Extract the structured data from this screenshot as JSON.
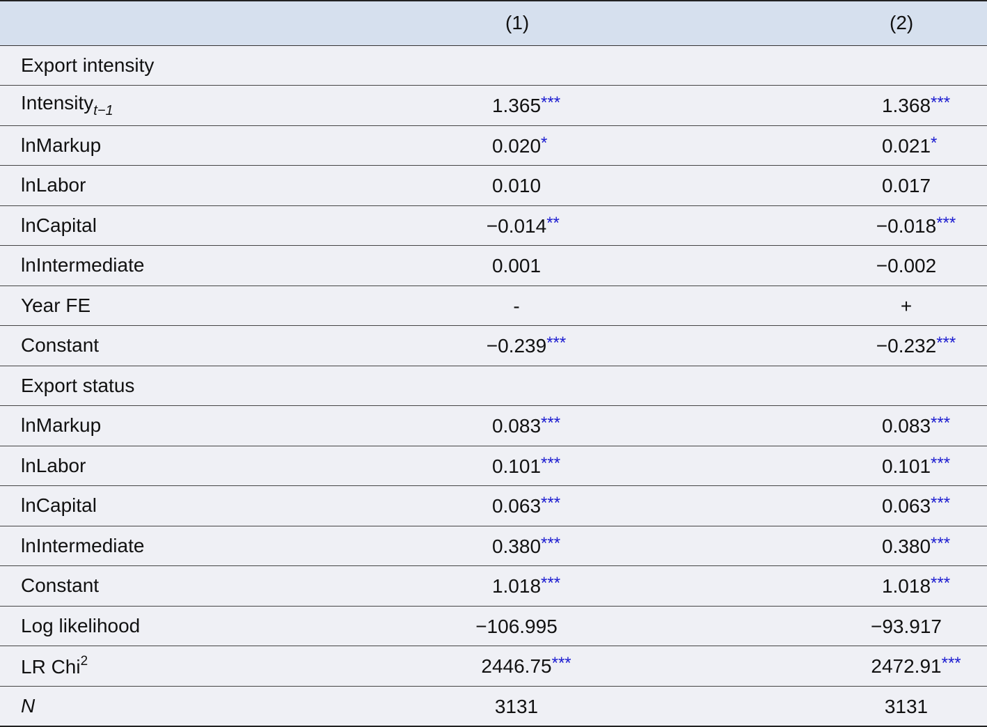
{
  "header": {
    "col0": "",
    "col1": "(1)",
    "col2": "(2)"
  },
  "rows": [
    {
      "label": "Export intensity",
      "v1": "",
      "s1": "",
      "v2": "",
      "s2": ""
    },
    {
      "label": "Intensity",
      "sub": "t−1",
      "v1": "1.365",
      "s1": "***",
      "v2": "1.368",
      "s2": "***"
    },
    {
      "label": "lnMarkup",
      "v1": "0.020",
      "s1": "*",
      "v2": "0.021",
      "s2": "*"
    },
    {
      "label": "lnLabor",
      "v1": "0.010",
      "s1": "",
      "v2": "0.017",
      "s2": ""
    },
    {
      "label": "lnCapital",
      "v1": "−0.014",
      "s1": "**",
      "v2": "−0.018",
      "s2": "***"
    },
    {
      "label": "lnIntermediate",
      "v1": "0.001",
      "s1": "",
      "v2": "−0.002",
      "s2": ""
    },
    {
      "label": "Year FE",
      "v1": "-",
      "s1": "",
      "v2": "+",
      "s2": ""
    },
    {
      "label": "Constant",
      "v1": "−0.239",
      "s1": "***",
      "v2": "−0.232",
      "s2": "***"
    },
    {
      "label": "Export status",
      "v1": "",
      "s1": "",
      "v2": "",
      "s2": ""
    },
    {
      "label": "lnMarkup",
      "v1": "0.083",
      "s1": "***",
      "v2": "0.083",
      "s2": "***"
    },
    {
      "label": "lnLabor",
      "v1": "0.101",
      "s1": "***",
      "v2": "0.101",
      "s2": "***"
    },
    {
      "label": "lnCapital",
      "v1": "0.063",
      "s1": "***",
      "v2": "0.063",
      "s2": "***"
    },
    {
      "label": "lnIntermediate",
      "v1": "0.380",
      "s1": "***",
      "v2": "0.380",
      "s2": "***"
    },
    {
      "label": "Constant",
      "v1": "1.018",
      "s1": "***",
      "v2": "1.018",
      "s2": "***"
    },
    {
      "label": "Log likelihood",
      "v1": "−106.995",
      "s1": "",
      "v2": "−93.917",
      "s2": ""
    },
    {
      "label": "LR Chi",
      "sup": "2",
      "v1": "2446.75",
      "s1": "***",
      "v2": "2472.91",
      "s2": "***"
    },
    {
      "label": "N",
      "italic": true,
      "v1": "3131",
      "s1": "",
      "v2": "3131",
      "s2": ""
    }
  ],
  "colors": {
    "header_bg": "#d6e0ee",
    "body_bg": "#eff0f5",
    "star_color": "#1b1bd0"
  }
}
